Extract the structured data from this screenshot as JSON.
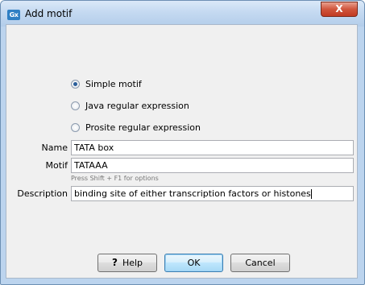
{
  "window": {
    "title": "Add motif",
    "app_icon_text": "Gx",
    "close_glyph": "X"
  },
  "radios": [
    {
      "label": "Simple motif",
      "checked": true
    },
    {
      "label": "Java regular expression",
      "checked": false
    },
    {
      "label": "Prosite regular expression",
      "checked": false
    }
  ],
  "fields": {
    "name_label": "Name",
    "name_value": "TATA box",
    "motif_label": "Motif",
    "motif_value": "TATAAA",
    "motif_hint": "Press Shift + F1 for options",
    "description_label": "Description",
    "description_value": "binding site of either transcription factors or histones"
  },
  "buttons": {
    "help_icon": "?",
    "help_label": "Help",
    "ok_label": "OK",
    "cancel_label": "Cancel"
  }
}
